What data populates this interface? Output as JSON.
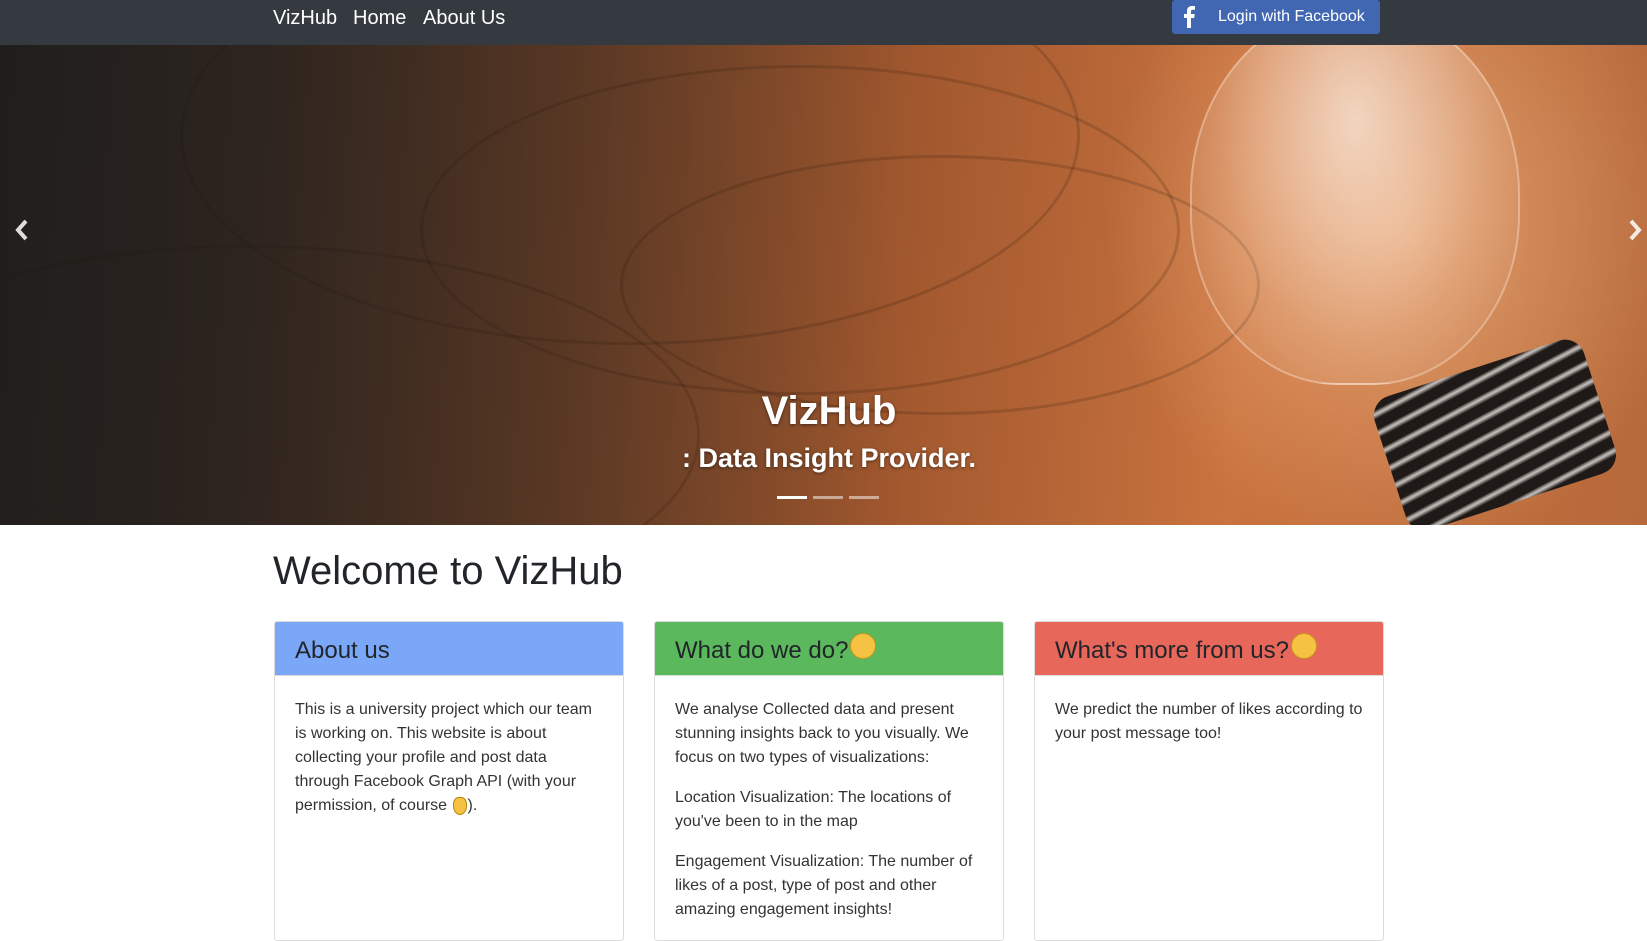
{
  "nav": {
    "brand": "VizHub",
    "home": "Home",
    "about": "About Us",
    "login_label": "Login with Facebook",
    "login_icon": "facebook-icon"
  },
  "hero": {
    "title": "VizHub",
    "subtitle": ": Data Insight Provider.",
    "prev_icon": "chevron-left-icon",
    "next_icon": "chevron-right-icon",
    "active_slide": 1,
    "slide_count": 3
  },
  "main": {
    "heading": "Welcome to VizHub",
    "cards": [
      {
        "title": "About us",
        "header_color": "#7aa7f7",
        "paragraphs": [
          "This is a university project which our team is working on. This website is about collecting your profile and post data through Facebook Graph API (with your permission, of course ",
          ")."
        ],
        "emoji": "ok-hand-icon"
      },
      {
        "title": "What do we do?",
        "header_color": "#5cb85c",
        "emoji": "thinking-face-icon",
        "paragraphs": [
          "We analyse Collected data and present stunning insights back to you visually. We focus on two types of visualizations:",
          "Location Visualization: The locations of you've been to in the map",
          "Engagement Visualization: The number of likes of a post, type of post and other amazing engagement insights!"
        ]
      },
      {
        "title": "What's more from us?",
        "header_color": "#e8675b",
        "emoji": "grinning-face-icon",
        "paragraphs": [
          "We predict the number of likes according to your post message too!"
        ]
      }
    ]
  },
  "colors": {
    "navbar": "#343a40",
    "facebook": "#4267b2"
  }
}
